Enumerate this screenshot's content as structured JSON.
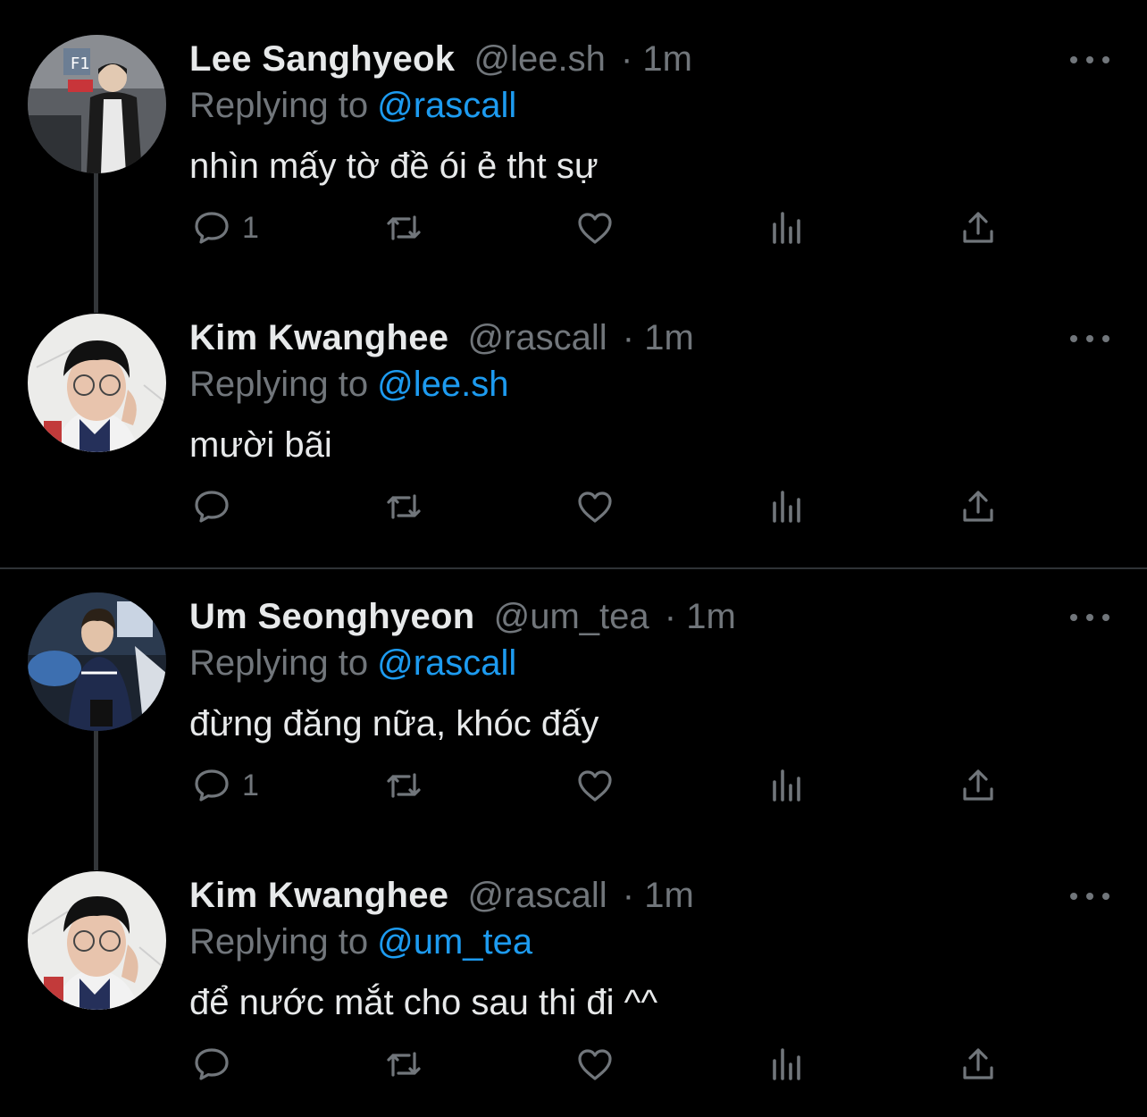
{
  "colors": {
    "background": "#000000",
    "text_primary": "#e7e9ea",
    "text_secondary": "#71767b",
    "accent": "#1d9bf0",
    "divider": "#2f3336"
  },
  "icons": [
    "reply-icon",
    "retweet-icon",
    "like-icon",
    "views-icon",
    "share-icon",
    "more-options-icon"
  ],
  "tweets": [
    {
      "name": "Lee Sanghyeok",
      "handle": "@lee.sh",
      "time": "· 1m",
      "replying_label": "Replying to",
      "replying_to": "@rascall",
      "text": "nhìn mấy tờ đề ói ẻ tht sự",
      "reply_count": "1"
    },
    {
      "name": "Kim Kwanghee",
      "handle": "@rascall",
      "time": "· 1m",
      "replying_label": "Replying to",
      "replying_to": "@lee.sh",
      "text": "mười bãi",
      "reply_count": ""
    },
    {
      "name": "Um Seonghyeon",
      "handle": "@um_tea",
      "time": "· 1m",
      "replying_label": "Replying to",
      "replying_to": "@rascall",
      "text": "đừng đăng nữa, khóc đấy",
      "reply_count": "1"
    },
    {
      "name": "Kim Kwanghee",
      "handle": "@rascall",
      "time": "· 1m",
      "replying_label": "Replying to",
      "replying_to": "@um_tea",
      "text": "để nước mắt cho sau thi đi ^^",
      "reply_count": ""
    }
  ]
}
